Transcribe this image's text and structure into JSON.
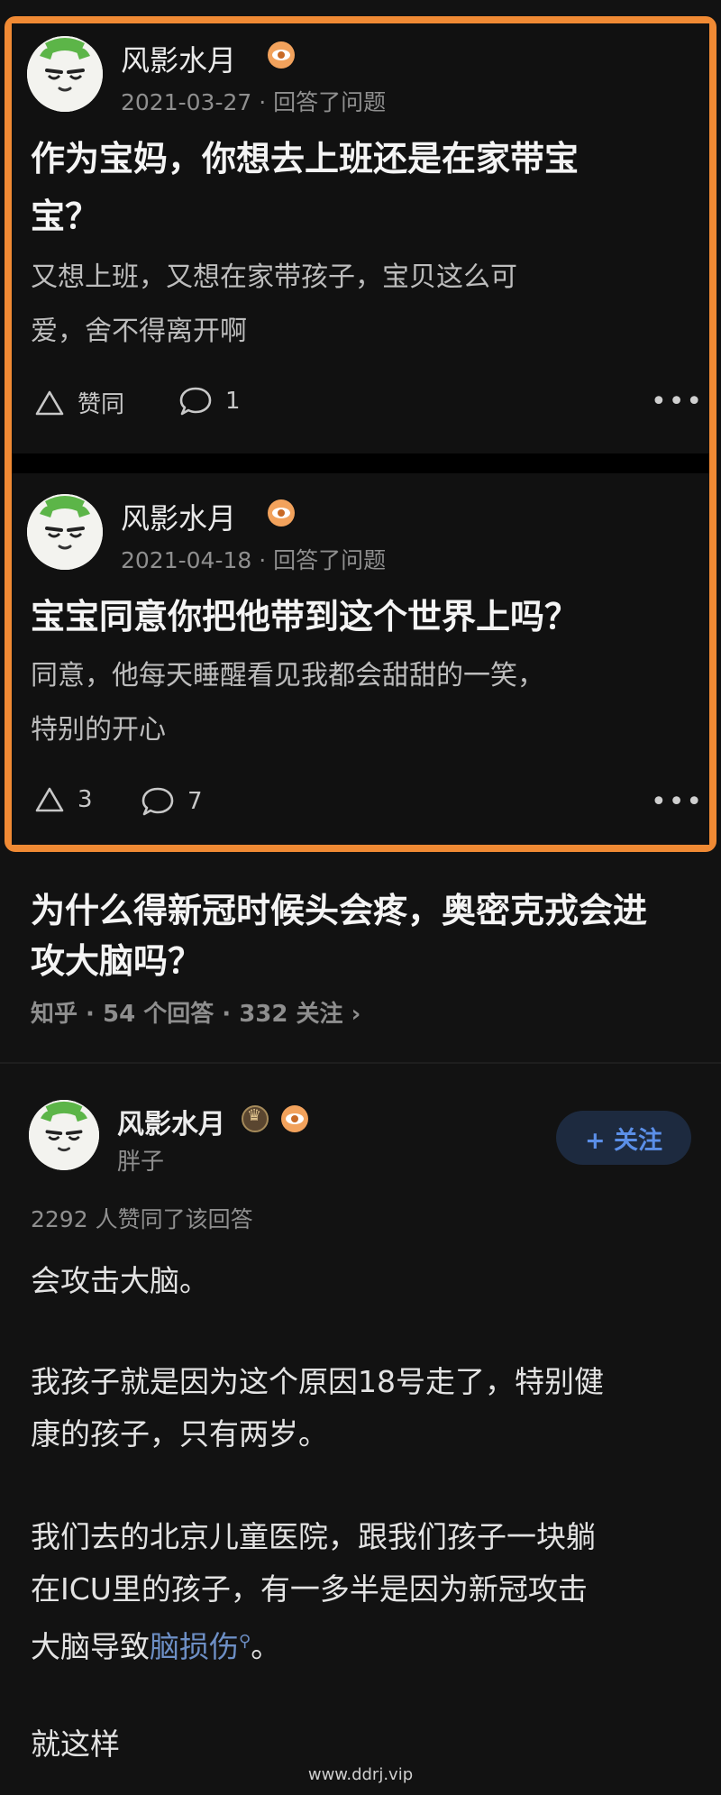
{
  "cards": [
    {
      "author": "风影水月",
      "date": "2021-03-27",
      "action": "回答了问题",
      "title_line1": "作为宝妈，你想去上班还是在家带宝",
      "title_line2": "宝？",
      "body_line1": "又想上班，又想在家带孩子，宝贝这么可",
      "body_line2": "爱，舍不得离开啊",
      "vote_label": "赞同",
      "comment_count": "1",
      "more": "•••"
    },
    {
      "author": "风影水月",
      "date": "2021-04-18",
      "action": "回答了问题",
      "title_line1": "宝宝同意你把他带到这个世界上吗？",
      "body_line1": "同意，他每天睡醒看见我都会甜甜的一笑，",
      "body_line2": "特别的开心",
      "vote_label": "3",
      "comment_count": "7",
      "more": "•••"
    }
  ],
  "question": {
    "title_line1": "为什么得新冠时候头会疼，奥密克戎会进",
    "title_line2": "攻大脑吗？",
    "meta": "知乎 · 54 个回答 · 332 关注 ›"
  },
  "answer": {
    "author": "风影水月",
    "subtitle": "胖子",
    "follow_label": "+ 关注",
    "like_text": "2292 人赞同了该回答",
    "p1": "会攻击大脑。",
    "p2_line1": "我孩子就是因为这个原因18号走了，特别健",
    "p2_line2": "康的孩子，只有两岁。",
    "p3_line1": "我们去的北京儿童医院，跟我们孩子一块躺",
    "p3_line2": "在ICU里的孩子，有一多半是因为新冠攻击",
    "p3_line3_pre": "大脑导致",
    "p3_link": "脑损伤",
    "p3_line3_post": "。",
    "p4": "就这样"
  },
  "watermark": "www.ddrj.vip",
  "colors": {
    "highlight": "#f08a34",
    "link": "#6d8fc5",
    "follow": "#5b8fe8"
  }
}
